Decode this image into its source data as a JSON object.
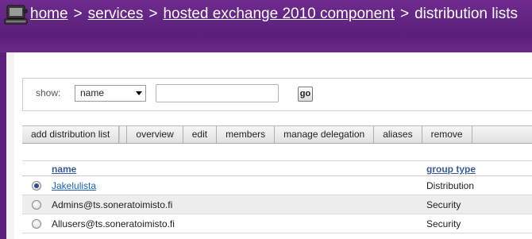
{
  "header": {
    "breadcrumb": [
      {
        "label": "home",
        "link": true
      },
      {
        "label": "services",
        "link": true
      },
      {
        "label": "hosted exchange 2010 component",
        "link": true
      },
      {
        "label": "distribution lists",
        "link": false
      }
    ],
    "separator": ">"
  },
  "filter": {
    "show_label": "show:",
    "field_selected": "name",
    "search_value": "",
    "go_label": "go"
  },
  "toolbar": {
    "add_label": "add distribution list",
    "overview_label": "overview",
    "edit_label": "edit",
    "members_label": "members",
    "manage_delegation_label": "manage delegation",
    "aliases_label": "aliases",
    "remove_label": "remove"
  },
  "table": {
    "columns": {
      "name": "name",
      "group_type": "group type"
    },
    "rows": [
      {
        "name": "Jakelulista",
        "group_type": "Distribution",
        "selected": true
      },
      {
        "name": "Admins@ts.soneratoimisto.fi",
        "group_type": "Security",
        "selected": false
      },
      {
        "name": "Allusers@ts.soneratoimisto.fi",
        "group_type": "Security",
        "selected": false
      }
    ]
  },
  "colors": {
    "header_purple": "#5c1f7a",
    "link_blue": "#1f5fb5",
    "column_header_blue": "#3a5a9a"
  }
}
